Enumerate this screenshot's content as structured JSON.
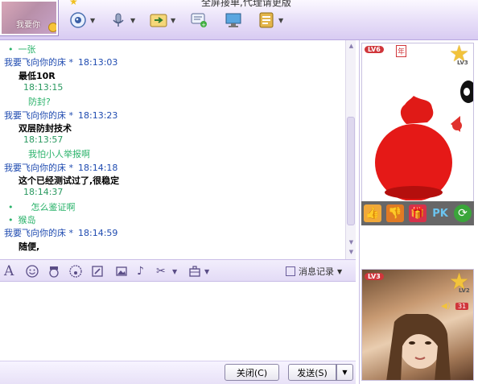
{
  "window": {
    "title": "全屏接单,代理请更版"
  },
  "avatar": {
    "caption": "我要你"
  },
  "toolbar": {
    "icons": [
      "video-icon",
      "microphone-icon",
      "file-transfer-icon",
      "sms-icon",
      "remote-desktop-icon",
      "app-menu-icon"
    ]
  },
  "chat": {
    "lines": [
      {
        "kind": "plain",
        "dot": "•",
        "text": "一张"
      },
      {
        "kind": "header",
        "sender": "我要飞向你的床 *",
        "time": "18:13:03"
      },
      {
        "kind": "message",
        "text": "最低10R"
      },
      {
        "kind": "gtime",
        "time": "18:13:15"
      },
      {
        "kind": "green",
        "text": "防封?"
      },
      {
        "kind": "header",
        "sender": "我要飞向你的床 *",
        "time": "18:13:23"
      },
      {
        "kind": "message",
        "text": "双层防封技术"
      },
      {
        "kind": "gtime",
        "time": "18:13:57"
      },
      {
        "kind": "green",
        "text": "我怕小人举报啊"
      },
      {
        "kind": "header",
        "sender": "我要飞向你的床 *",
        "time": "18:14:18"
      },
      {
        "kind": "message",
        "text": "这个已经测试过了,很稳定"
      },
      {
        "kind": "gtime",
        "time": "18:14:37"
      },
      {
        "kind": "plain",
        "dot": "•",
        "text": "怎么鉴证啊"
      },
      {
        "kind": "plain",
        "dot": "•",
        "text": "猴岛"
      },
      {
        "kind": "header",
        "sender": "我要飞向你的床 *",
        "time": "18:14:59"
      },
      {
        "kind": "message",
        "text": "随便,"
      }
    ]
  },
  "format_toolbar": {
    "font_glyph": "A",
    "message_record_label": "消息记录"
  },
  "input": {
    "value": "",
    "placeholder": ""
  },
  "buttons": {
    "close_label": "关闭(C)",
    "send_label": "发送(S)"
  },
  "show_panel_top": {
    "level_badge": "LV6",
    "year_badge": "年",
    "star_level": "LV3",
    "actions": [
      "thumbs-up-icon",
      "thumbs-down-icon",
      "gift-icon",
      "pk-icon",
      "refresh-icon"
    ],
    "pk_label": "PK"
  },
  "show_panel_bottom": {
    "level_badge": "LV3",
    "star_level": "LV2",
    "volume": "31"
  },
  "colors": {
    "accent": "#d8cbf2",
    "sender": "#1f4bb0",
    "friend_message": "#2bb36b"
  }
}
